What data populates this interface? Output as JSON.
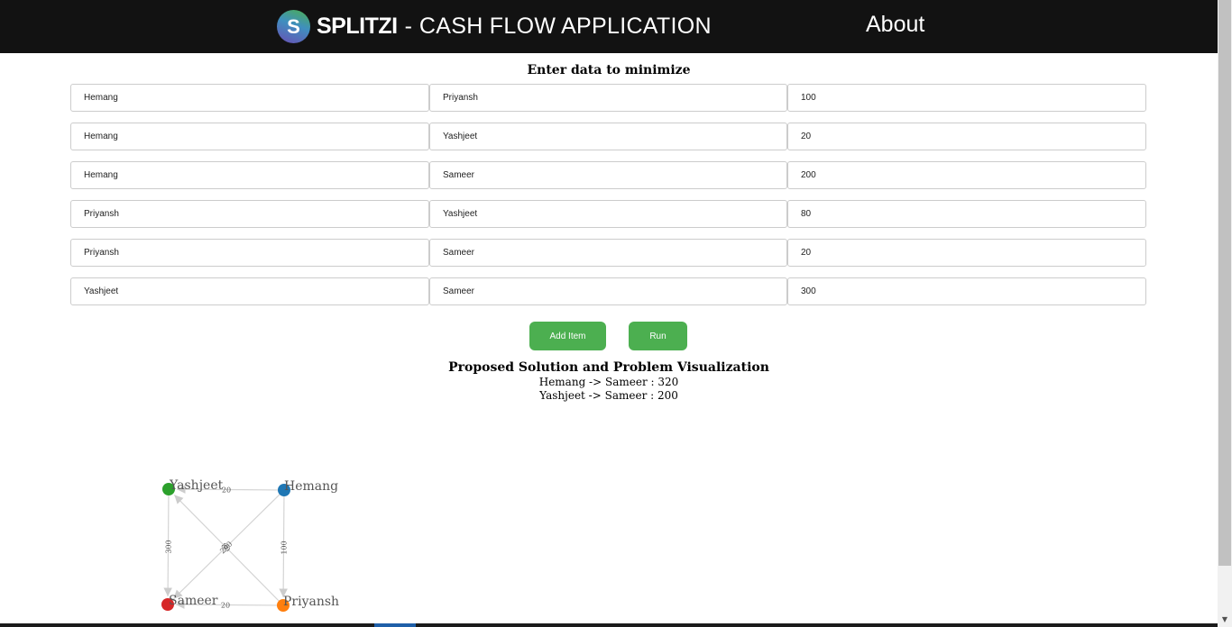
{
  "header": {
    "logo_letter": "S",
    "brand_name": "SPLITZI",
    "separator": "-",
    "tagline": "CASH FLOW APPLICATION",
    "about_link": "About",
    "background_color": "#121212"
  },
  "form": {
    "title": "Enter data to minimize",
    "rows": [
      {
        "from": "Hemang",
        "to": "Priyansh",
        "amount": "100"
      },
      {
        "from": "Hemang",
        "to": "Yashjeet",
        "amount": "20"
      },
      {
        "from": "Hemang",
        "to": "Sameer",
        "amount": "200"
      },
      {
        "from": "Priyansh",
        "to": "Yashjeet",
        "amount": "80"
      },
      {
        "from": "Priyansh",
        "to": "Sameer",
        "amount": "20"
      },
      {
        "from": "Yashjeet",
        "to": "Sameer",
        "amount": "300"
      }
    ],
    "add_button": "Add Item",
    "run_button": "Run",
    "button_color": "#4caf50"
  },
  "solution": {
    "title": "Proposed Solution and Problem Visualization",
    "lines": [
      "Hemang -> Sameer : 320",
      "Yashjeet -> Sameer : 200"
    ]
  },
  "graph": {
    "nodes": [
      {
        "id": "yashjeet",
        "label": "Yashjeet",
        "color": "#2ca02c"
      },
      {
        "id": "hemang",
        "label": "Hemang",
        "color": "#1f77b4"
      },
      {
        "id": "sameer",
        "label": "Sameer",
        "color": "#d62728"
      },
      {
        "id": "priyansh",
        "label": "Priyansh",
        "color": "#ff7f0e"
      }
    ],
    "edges": [
      {
        "source": "hemang",
        "target": "yashjeet",
        "label": "20"
      },
      {
        "source": "hemang",
        "target": "priyansh",
        "label": "100"
      },
      {
        "source": "hemang",
        "target": "sameer",
        "label": "200"
      },
      {
        "source": "priyansh",
        "target": "yashjeet",
        "label": "80"
      },
      {
        "source": "yashjeet",
        "target": "sameer",
        "label": "300"
      },
      {
        "source": "priyansh",
        "target": "sameer",
        "label": "20"
      }
    ]
  }
}
